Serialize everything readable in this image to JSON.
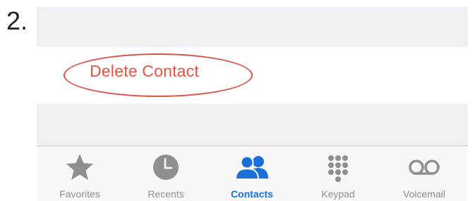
{
  "step": {
    "number": "2."
  },
  "screen": {
    "delete_label": "Delete Contact",
    "highlight_color": "#df4f43",
    "delete_color": "#e8533d"
  },
  "tabbar": {
    "active_color": "#1b6fd9",
    "inactive_color": "#8e8e93",
    "tabs": [
      {
        "label": "Favorites",
        "icon": "star-icon",
        "active": false
      },
      {
        "label": "Recents",
        "icon": "clock-icon",
        "active": false
      },
      {
        "label": "Contacts",
        "icon": "contacts-icon",
        "active": true
      },
      {
        "label": "Keypad",
        "icon": "keypad-icon",
        "active": false
      },
      {
        "label": "Voicemail",
        "icon": "voicemail-icon",
        "active": false
      }
    ]
  }
}
